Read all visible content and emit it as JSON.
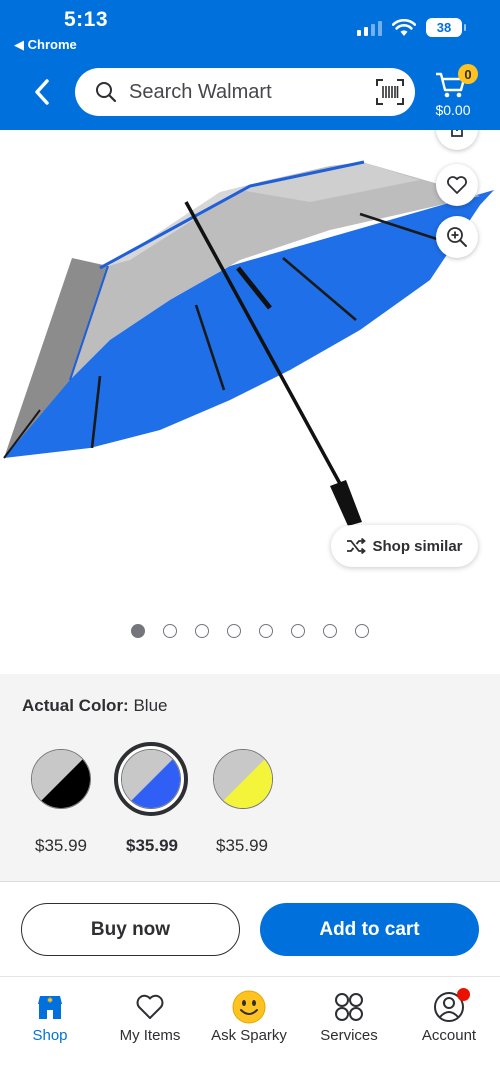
{
  "status_bar": {
    "time": "5:13",
    "back_app": "◀ Chrome",
    "battery": "38"
  },
  "header": {
    "search_placeholder": "Search Walmart",
    "cart_count": "0",
    "cart_total": "$0.00",
    "colors": {
      "brand_blue": "#0071dc",
      "badge_yellow": "#ffc220"
    }
  },
  "gallery": {
    "shop_similar_label": "Shop similar",
    "image_count": 8,
    "active_index": 0
  },
  "variants": {
    "actual_color_label": "Actual Color:",
    "actual_color_value": "Blue",
    "options": [
      {
        "price": "$35.99",
        "colors": [
          "#c8c8c8",
          "#000000"
        ],
        "selected": false
      },
      {
        "price": "$35.99",
        "colors": [
          "#c8c8c8",
          "#2f5ff5"
        ],
        "selected": true
      },
      {
        "price": "$35.99",
        "colors": [
          "#c8c8c8",
          "#f4f43a"
        ],
        "selected": false
      }
    ]
  },
  "actions": {
    "buy_now": "Buy now",
    "add_to_cart": "Add to cart"
  },
  "bottom_nav": {
    "items": [
      {
        "label": "Shop",
        "icon": "shop-icon",
        "active": true
      },
      {
        "label": "My Items",
        "icon": "heart-icon",
        "active": false
      },
      {
        "label": "Ask Sparky",
        "icon": "sparky-icon",
        "active": false
      },
      {
        "label": "Services",
        "icon": "services-icon",
        "active": false
      },
      {
        "label": "Account",
        "icon": "account-icon",
        "active": false
      }
    ]
  }
}
